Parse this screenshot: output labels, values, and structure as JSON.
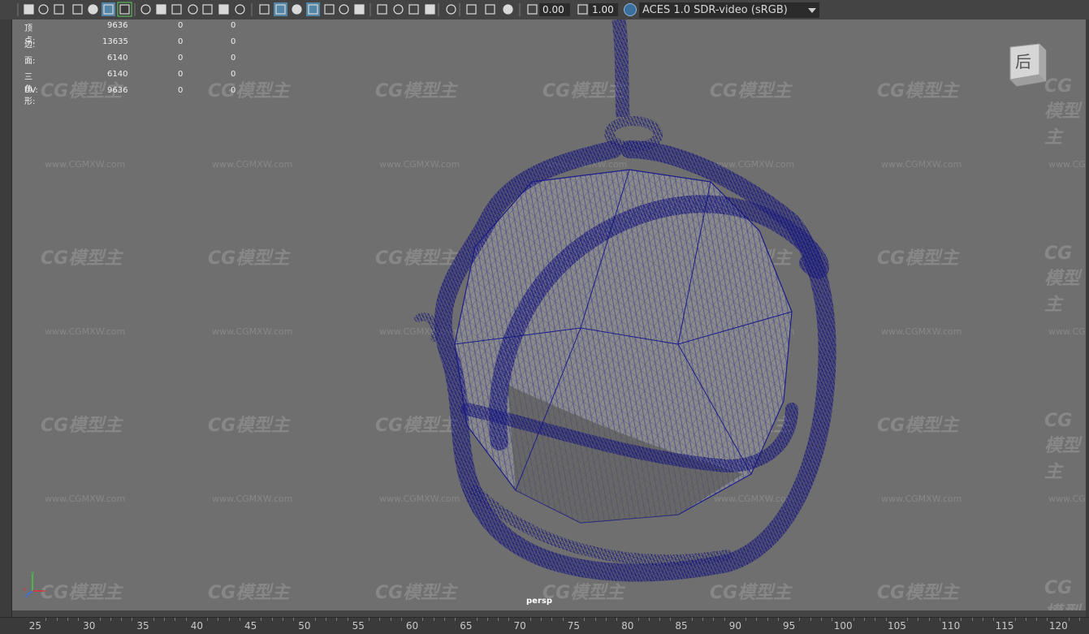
{
  "toolbar": {
    "exposure_value": "0.00",
    "gamma_value": "1.00",
    "color_space": "ACES 1.0 SDR-video (sRGB)",
    "icons": [
      "camera-select-icon",
      "camera-lock-icon",
      "camera-attributes-icon",
      "bookmark-icon",
      "image-plane-icon",
      "2d-pan-zoom-icon",
      "grease-pencil-icon",
      "grid-icon",
      "film-gate-icon",
      "resolution-gate-icon",
      "gate-mask-icon",
      "field-chart-icon",
      "safe-action-icon",
      "safe-title-icon",
      "wireframe-icon",
      "smooth-shade-icon",
      "default-material-icon",
      "wireframe-on-shaded-icon",
      "textured-icon",
      "use-all-lights-icon",
      "shadows-icon",
      "screen-space-ao-icon",
      "motion-blur-icon",
      "anti-aliasing-icon",
      "depth-of-field-icon",
      "isolate-select-icon",
      "xray-icon",
      "xray-joints-icon",
      "xray-components-icon",
      "exposure-icon",
      "gamma-icon",
      "color-management-icon"
    ]
  },
  "hud": {
    "rows": [
      {
        "label": "顶点:",
        "total": "9636",
        "selected": "0",
        "extra": "0"
      },
      {
        "label": "边:",
        "total": "13635",
        "selected": "0",
        "extra": "0"
      },
      {
        "label": "面:",
        "total": "6140",
        "selected": "0",
        "extra": "0"
      },
      {
        "label": "三角形:",
        "total": "6140",
        "selected": "0",
        "extra": "0"
      },
      {
        "label": "UV:",
        "total": "9636",
        "selected": "0",
        "extra": "0"
      }
    ]
  },
  "viewport": {
    "camera_label": "persp",
    "viewcube_face": "后",
    "watermark_logo": "CG模型主",
    "watermark_url": "www.CGMXW.com",
    "axis": {
      "x": "x",
      "y": "y",
      "z": "z"
    }
  },
  "timeline": {
    "ticks": [
      "25",
      "30",
      "35",
      "40",
      "45",
      "50",
      "55",
      "60",
      "65",
      "70",
      "75",
      "80",
      "85",
      "90",
      "95",
      "100",
      "105",
      "110",
      "115",
      "120"
    ]
  }
}
